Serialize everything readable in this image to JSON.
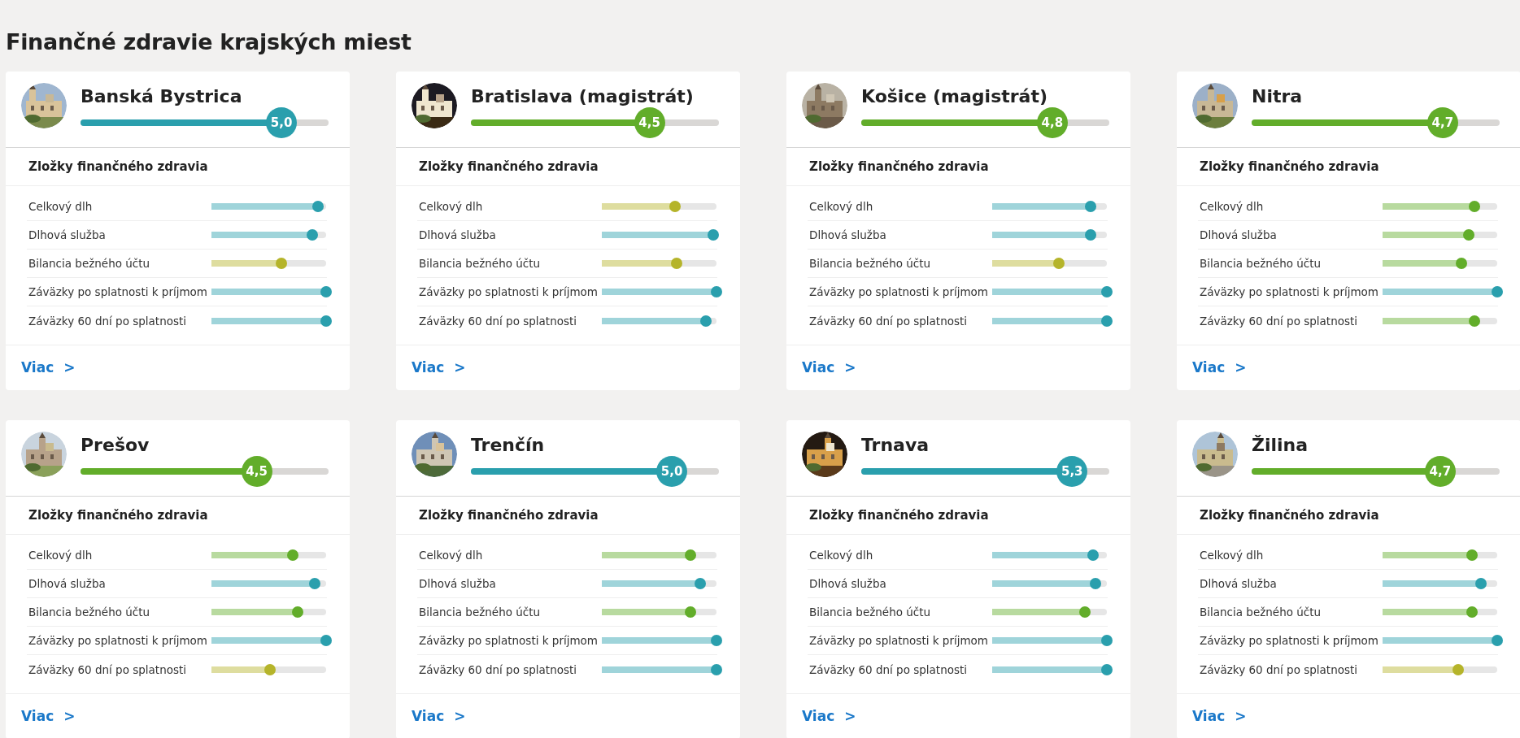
{
  "title": "Finančné zdravie krajských miest",
  "cities": [
    {
      "name": "Banská Bystrica",
      "score": "5,0",
      "level": 0.81,
      "color": "#2a9fad",
      "section": "Zložky finančného zdravia",
      "link": "Viac >",
      "metrics": [
        {
          "label": "Celkový dlh",
          "level": 0.93,
          "color": "#2a9fad"
        },
        {
          "label": "Dlhová služba",
          "level": 0.88,
          "color": "#2a9fad"
        },
        {
          "label": "Bilancia bežného účtu",
          "level": 0.61,
          "color": "#b5b42a"
        },
        {
          "label": "Záväzky po splatnosti k príjmom",
          "level": 1,
          "color": "#2a9fad"
        },
        {
          "label": "Záväzky 60 dní po splatnosti",
          "level": 1,
          "color": "#2a9fad"
        }
      ]
    },
    {
      "name": "Bratislava (magistrát)",
      "score": "4,5",
      "level": 0.72,
      "color": "#62ad2a",
      "section": "Zložky finančného zdravia",
      "link": "Viac >",
      "metrics": [
        {
          "label": "Celkový dlh",
          "level": 0.64,
          "color": "#b5b42a"
        },
        {
          "label": "Dlhová služba",
          "level": 0.97,
          "color": "#2a9fad"
        },
        {
          "label": "Bilancia bežného účtu",
          "level": 0.65,
          "color": "#b5b42a"
        },
        {
          "label": "Záväzky po splatnosti k príjmom",
          "level": 1,
          "color": "#2a9fad"
        },
        {
          "label": "Záväzky 60 dní po splatnosti",
          "level": 0.91,
          "color": "#2a9fad"
        }
      ]
    },
    {
      "name": "Košice (magistrát)",
      "score": "4,8",
      "level": 0.77,
      "color": "#62ad2a",
      "section": "Zložky finančného zdravia",
      "link": "Viac >",
      "metrics": [
        {
          "label": "Celkový dlh",
          "level": 0.86,
          "color": "#2a9fad"
        },
        {
          "label": "Dlhová služba",
          "level": 0.86,
          "color": "#2a9fad"
        },
        {
          "label": "Bilancia bežného účtu",
          "level": 0.58,
          "color": "#b5b42a"
        },
        {
          "label": "Záväzky po splatnosti k príjmom",
          "level": 1,
          "color": "#2a9fad"
        },
        {
          "label": "Záväzky 60 dní po splatnosti",
          "level": 1,
          "color": "#2a9fad"
        }
      ]
    },
    {
      "name": "Nitra",
      "score": "4,7",
      "level": 0.77,
      "color": "#62ad2a",
      "section": "Zložky finančného zdravia",
      "link": "Viac >",
      "metrics": [
        {
          "label": "Celkový dlh",
          "level": 0.8,
          "color": "#62ad2a"
        },
        {
          "label": "Dlhová služba",
          "level": 0.75,
          "color": "#62ad2a"
        },
        {
          "label": "Bilancia bežného účtu",
          "level": 0.69,
          "color": "#62ad2a"
        },
        {
          "label": "Záväzky po splatnosti k príjmom",
          "level": 1,
          "color": "#2a9fad"
        },
        {
          "label": "Záväzky 60 dní po splatnosti",
          "level": 0.8,
          "color": "#62ad2a"
        }
      ]
    },
    {
      "name": "Prešov",
      "score": "4,5",
      "level": 0.71,
      "color": "#62ad2a",
      "section": "Zložky finančného zdravia",
      "link": "Viac >",
      "metrics": [
        {
          "label": "Celkový dlh",
          "level": 0.71,
          "color": "#62ad2a"
        },
        {
          "label": "Dlhová služba",
          "level": 0.9,
          "color": "#2a9fad"
        },
        {
          "label": "Bilancia bežného účtu",
          "level": 0.75,
          "color": "#62ad2a"
        },
        {
          "label": "Záväzky po splatnosti k príjmom",
          "level": 1,
          "color": "#2a9fad"
        },
        {
          "label": "Záväzky 60 dní po splatnosti",
          "level": 0.51,
          "color": "#b5b42a"
        }
      ]
    },
    {
      "name": "Trenčín",
      "score": "5,0",
      "level": 0.81,
      "color": "#2a9fad",
      "section": "Zložky finančného zdravia",
      "link": "Viac >",
      "metrics": [
        {
          "label": "Celkový dlh",
          "level": 0.77,
          "color": "#62ad2a"
        },
        {
          "label": "Dlhová služba",
          "level": 0.86,
          "color": "#2a9fad"
        },
        {
          "label": "Bilancia bežného účtu",
          "level": 0.77,
          "color": "#62ad2a"
        },
        {
          "label": "Záväzky po splatnosti k príjmom",
          "level": 1,
          "color": "#2a9fad"
        },
        {
          "label": "Záväzky 60 dní po splatnosti",
          "level": 1,
          "color": "#2a9fad"
        }
      ]
    },
    {
      "name": "Trnava",
      "score": "5,3",
      "level": 0.85,
      "color": "#2a9fad",
      "section": "Zložky finančného zdravia",
      "link": "Viac >",
      "metrics": [
        {
          "label": "Celkový dlh",
          "level": 0.88,
          "color": "#2a9fad"
        },
        {
          "label": "Dlhová služba",
          "level": 0.9,
          "color": "#2a9fad"
        },
        {
          "label": "Bilancia bežného účtu",
          "level": 0.81,
          "color": "#62ad2a"
        },
        {
          "label": "Záväzky po splatnosti k príjmom",
          "level": 1,
          "color": "#2a9fad"
        },
        {
          "label": "Záväzky 60 dní po splatnosti",
          "level": 1,
          "color": "#2a9fad"
        }
      ]
    },
    {
      "name": "Žilina",
      "score": "4,7",
      "level": 0.76,
      "color": "#62ad2a",
      "section": "Zložky finančného zdravia",
      "link": "Viac >",
      "metrics": [
        {
          "label": "Celkový dlh",
          "level": 0.78,
          "color": "#62ad2a"
        },
        {
          "label": "Dlhová služba",
          "level": 0.86,
          "color": "#2a9fad"
        },
        {
          "label": "Bilancia bežného účtu",
          "level": 0.78,
          "color": "#62ad2a"
        },
        {
          "label": "Záväzky po splatnosti k príjmom",
          "level": 1,
          "color": "#2a9fad"
        },
        {
          "label": "Záväzky 60 dní po splatnosti",
          "level": 0.66,
          "color": "#b5b42a"
        }
      ]
    }
  ]
}
